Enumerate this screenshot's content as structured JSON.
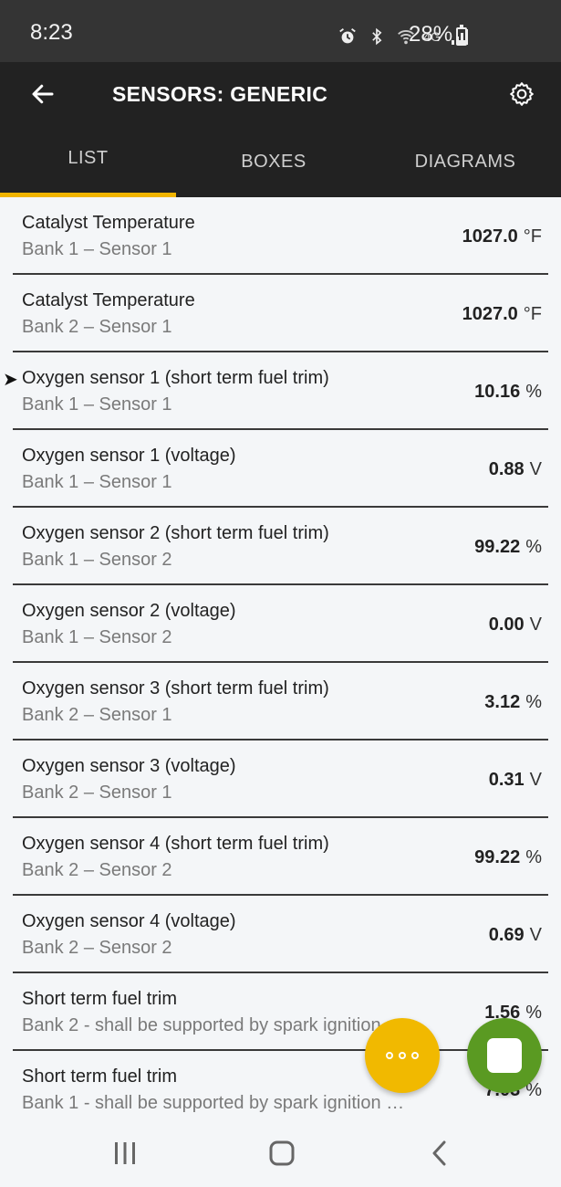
{
  "status_bar": {
    "time": "8:23",
    "network": "4G",
    "battery": "28%",
    "battery_level": 0.28
  },
  "app_bar": {
    "title": "SENSORS: GENERIC"
  },
  "tabs": [
    {
      "label": "LIST",
      "active": true
    },
    {
      "label": "BOXES",
      "active": false
    },
    {
      "label": "DIAGRAMS",
      "active": false
    }
  ],
  "sensors": [
    {
      "name": "Catalyst Temperature",
      "sub": "Bank 1 – Sensor 1",
      "value": "1027.0",
      "unit": "°F"
    },
    {
      "name": "Catalyst Temperature",
      "sub": "Bank 2 – Sensor 1",
      "value": "1027.0",
      "unit": "°F"
    },
    {
      "name": "Oxygen sensor 1 (short term fuel trim)",
      "sub": "Bank 1 – Sensor 1",
      "value": "10.16",
      "unit": "%",
      "marker": "➤"
    },
    {
      "name": "Oxygen sensor 1 (voltage)",
      "sub": "Bank 1 – Sensor 1",
      "value": "0.88",
      "unit": "V"
    },
    {
      "name": "Oxygen sensor 2 (short term fuel trim)",
      "sub": "Bank 1 – Sensor 2",
      "value": "99.22",
      "unit": "%"
    },
    {
      "name": "Oxygen sensor 2 (voltage)",
      "sub": "Bank 1 – Sensor 2",
      "value": "0.00",
      "unit": "V"
    },
    {
      "name": "Oxygen sensor 3 (short term fuel trim)",
      "sub": "Bank 2 – Sensor 1",
      "value": "3.12",
      "unit": "%"
    },
    {
      "name": "Oxygen sensor 3 (voltage)",
      "sub": "Bank 2 – Sensor 1",
      "value": "0.31",
      "unit": "V"
    },
    {
      "name": "Oxygen sensor 4 (short term fuel trim)",
      "sub": "Bank 2 – Sensor 2",
      "value": "99.22",
      "unit": "%"
    },
    {
      "name": "Oxygen sensor 4 (voltage)",
      "sub": "Bank 2 – Sensor 2",
      "value": "0.69",
      "unit": "V"
    },
    {
      "name": "Short term fuel trim",
      "sub": "Bank 2 - shall be supported by spark ignition",
      "value": "1.56",
      "unit": "%"
    },
    {
      "name": "Short term fuel trim",
      "sub": "Bank 1 - shall be supported by spark ignition …",
      "value": "7.03",
      "unit": "%"
    }
  ],
  "icons": {
    "back": "arrow-back-icon",
    "settings": "gear-icon",
    "more": "more-horizontal-icon",
    "stop": "stop-square-icon",
    "nav_recents": "recents-icon",
    "nav_home": "home-icon",
    "nav_back": "chevron-left-icon"
  },
  "colors": {
    "accent": "#f0b400",
    "fab_more": "#f1b900",
    "fab_stop": "#5a9a22",
    "app_bar": "#222222"
  }
}
